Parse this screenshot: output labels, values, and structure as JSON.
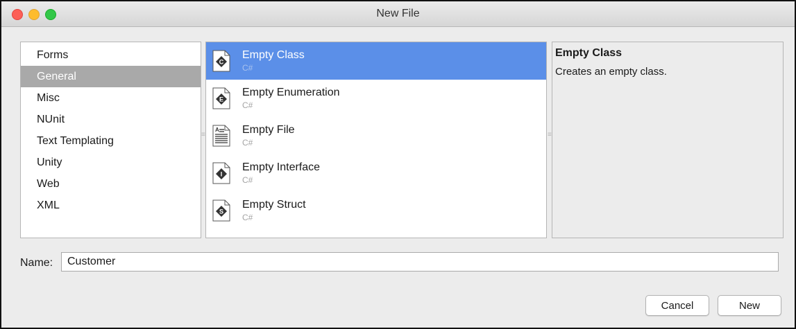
{
  "window": {
    "title": "New File"
  },
  "categories": [
    {
      "label": "Forms",
      "selected": false
    },
    {
      "label": "General",
      "selected": true
    },
    {
      "label": "Misc",
      "selected": false
    },
    {
      "label": "NUnit",
      "selected": false
    },
    {
      "label": "Text Templating",
      "selected": false
    },
    {
      "label": "Unity",
      "selected": false
    },
    {
      "label": "Web",
      "selected": false
    },
    {
      "label": "XML",
      "selected": false
    }
  ],
  "templates": [
    {
      "name": "Empty Class",
      "language": "C#",
      "icon": "class-icon",
      "letter": "C",
      "selected": true
    },
    {
      "name": "Empty Enumeration",
      "language": "C#",
      "icon": "enum-icon",
      "letter": "E",
      "selected": false
    },
    {
      "name": "Empty File",
      "language": "C#",
      "icon": "file-icon",
      "letter": "A",
      "selected": false
    },
    {
      "name": "Empty Interface",
      "language": "C#",
      "icon": "interface-icon",
      "letter": "I",
      "selected": false
    },
    {
      "name": "Empty Struct",
      "language": "C#",
      "icon": "struct-icon",
      "letter": "S",
      "selected": false
    }
  ],
  "description": {
    "title": "Empty Class",
    "text": "Creates an empty class."
  },
  "name_field": {
    "label": "Name:",
    "value": "Customer"
  },
  "buttons": {
    "cancel_label": "Cancel",
    "new_label": "New"
  },
  "colors": {
    "selection_blue": "#5b8fe8",
    "category_selected": "#a9a9a9",
    "close": "#fc5f57",
    "minimize": "#fdbc2e",
    "maximize": "#33c748"
  }
}
